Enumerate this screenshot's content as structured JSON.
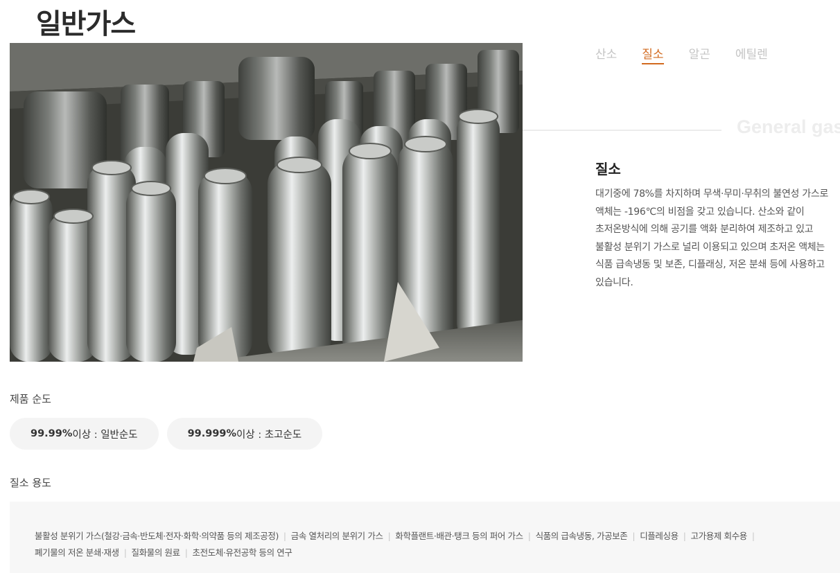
{
  "page": {
    "title": "일반가스",
    "watermark": "General gas"
  },
  "tabs": [
    {
      "label": "산소",
      "active": false
    },
    {
      "label": "질소",
      "active": true
    },
    {
      "label": "알곤",
      "active": false
    },
    {
      "label": "에틸렌",
      "active": false
    }
  ],
  "gas": {
    "name": "질소",
    "description": "대기중에 78%를 차지하며 무색·무미·무취의 불연성 가스로 액체는 -196℃의 비점을 갖고 있습니다. 산소와 같이 초저온방식에 의해 공기를 액화 분리하여 제조하고 있고 불활성 분위기 가스로 널리 이용되고 있으며 초저온 액체는 식품 급속냉동 및 보존, 디플래싱, 저온 분쇄 등에 사용하고 있습니다."
  },
  "purity": {
    "label": "제품 순도",
    "items": [
      {
        "value": "99.99%",
        "suffix": "이상 : 일반순도"
      },
      {
        "value": "99.999%",
        "suffix": "이상 : 초고순도"
      }
    ]
  },
  "usage": {
    "label": "질소 용도",
    "items": [
      "불활성 분위기 가스(철강·금속·반도체·전자·화학·의약품 등의 제조공정)",
      "금속 열처리의 분위기 가스",
      "화학플랜트·배관·탱크 등의 퍼어 가스",
      "식품의 급속냉동, 가공보존",
      "디플레싱용",
      "고가용제 회수용",
      "폐기물의 저온 분쇄·재생",
      "질화물의 원료",
      "초전도체·유전공학 등의 연구"
    ]
  },
  "colors": {
    "accent": "#d2691e",
    "tab_inactive": "#c4c4c4",
    "pill_bg": "#f4f4f4",
    "usage_bg": "#f7f7f7"
  }
}
